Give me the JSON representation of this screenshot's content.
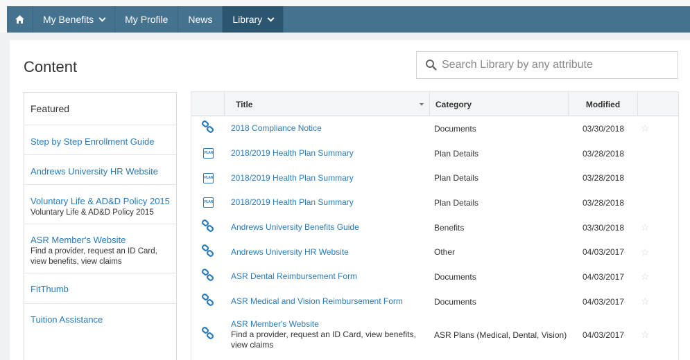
{
  "nav": {
    "home_icon": "home-icon",
    "items": [
      {
        "label": "My Benefits",
        "dropdown": true
      },
      {
        "label": "My Profile",
        "dropdown": false
      },
      {
        "label": "News",
        "dropdown": false
      },
      {
        "label": "Library",
        "dropdown": true,
        "active": true
      }
    ]
  },
  "page": {
    "title": "Content"
  },
  "search": {
    "placeholder": "Search Library by any attribute",
    "icon": "search-icon"
  },
  "featured": {
    "heading": "Featured",
    "items": [
      {
        "title": "Step by Step Enrollment Guide",
        "desc": ""
      },
      {
        "title": "Andrews University HR Website",
        "desc": ""
      },
      {
        "title": "Voluntary Life & AD&D Policy 2015",
        "desc": "Voluntary Life & AD&D Policy 2015"
      },
      {
        "title": "ASR Member's Website",
        "desc": "Find a provider, request an ID Card, view benefits, view claims"
      },
      {
        "title": "FitThumb",
        "desc": ""
      },
      {
        "title": "Tuition Assistance",
        "desc": ""
      }
    ]
  },
  "table": {
    "columns": {
      "title": "Title",
      "category": "Category",
      "modified": "Modified"
    },
    "rows": [
      {
        "icon": "link-icon",
        "title": "2018 Compliance Notice",
        "desc": "",
        "category": "Documents",
        "modified": "03/30/2018",
        "star": true
      },
      {
        "icon": "plan-icon",
        "plan_text": "PLAN",
        "title": "2018/2019 Health Plan Summary",
        "desc": "",
        "category": "Plan Details",
        "modified": "03/28/2018",
        "star": false
      },
      {
        "icon": "plan-icon",
        "plan_text": "PLAN",
        "title": "2018/2019 Health Plan Summary",
        "desc": "",
        "category": "Plan Details",
        "modified": "03/28/2018",
        "star": false
      },
      {
        "icon": "plan-icon",
        "plan_text": "PLAN",
        "title": "2018/2019 Health Plan Summary",
        "desc": "",
        "category": "Plan Details",
        "modified": "03/28/2018",
        "star": false
      },
      {
        "icon": "link-icon",
        "title": "Andrews University Benefits Guide",
        "desc": "",
        "category": "Benefits",
        "modified": "03/30/2018",
        "star": true
      },
      {
        "icon": "link-icon",
        "title": "Andrews University HR Website",
        "desc": "",
        "category": "Other",
        "modified": "04/03/2017",
        "star": true
      },
      {
        "icon": "link-icon",
        "title": "ASR Dental Reimbursement Form",
        "desc": "",
        "category": "Documents",
        "modified": "04/03/2017",
        "star": true
      },
      {
        "icon": "link-icon",
        "title": "ASR Medical and Vision Reimbursement Form",
        "desc": "",
        "category": "Documents",
        "modified": "04/03/2017",
        "star": true
      },
      {
        "icon": "link-icon",
        "title": "ASR Member's Website",
        "desc": "Find a provider, request an ID Card, view benefits, view claims",
        "category": "ASR Plans (Medical, Dental, Vision)",
        "modified": "04/03/2017",
        "star": true
      }
    ]
  },
  "colors": {
    "nav_bg": "#45738f",
    "nav_active": "#2b5670",
    "link": "#2a7ab8"
  }
}
